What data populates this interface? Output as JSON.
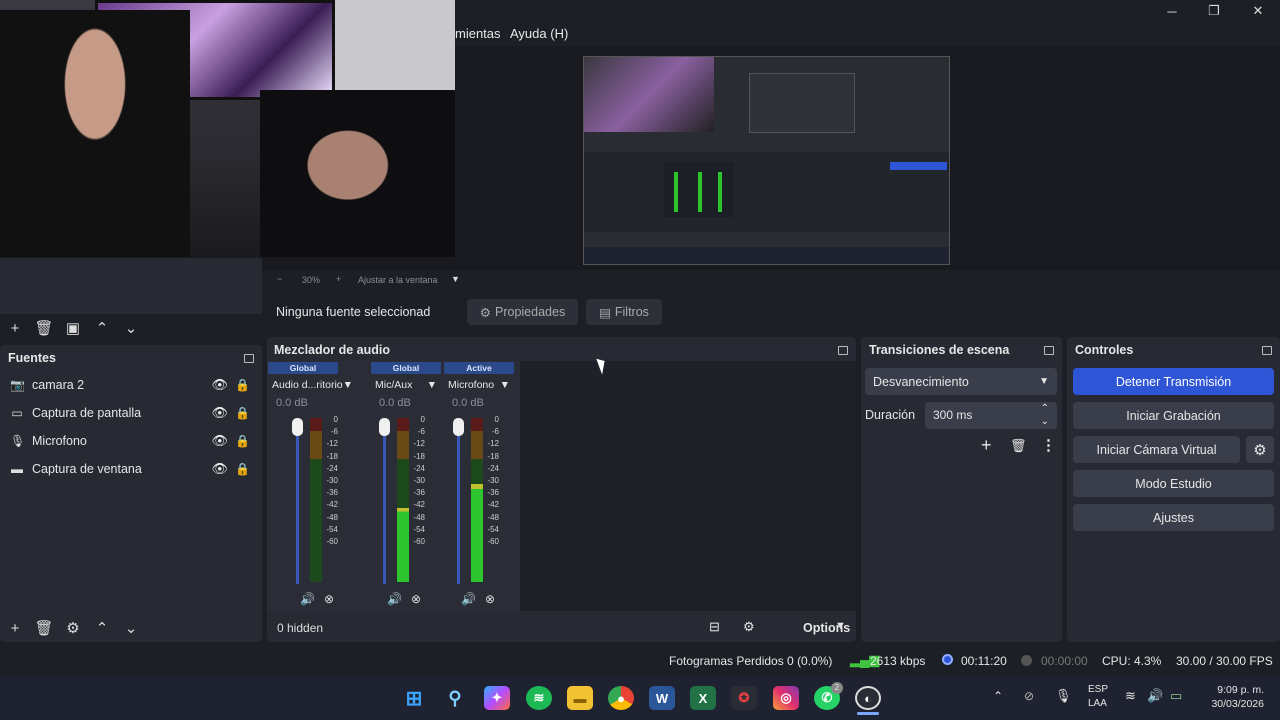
{
  "window": {
    "minimize": "─",
    "maximize": "❐",
    "close": "✕"
  },
  "menu": {
    "tools_partial": "mientas",
    "help": "Ayuda (H)"
  },
  "preview": {
    "zoom": "30%",
    "fit_label": "Ajustar a la ventana"
  },
  "source_bar": {
    "no_source": "Ninguna fuente seleccionad",
    "properties": "Propiedades",
    "filters": "Filtros"
  },
  "sources": {
    "title": "Fuentes",
    "items": [
      {
        "label": "camara 2",
        "icon": "camera-icon"
      },
      {
        "label": "Captura de pantalla",
        "icon": "monitor-icon"
      },
      {
        "label": "Microfono",
        "icon": "microphone-icon"
      },
      {
        "label": "Captura de ventana",
        "icon": "window-icon"
      }
    ]
  },
  "mixer": {
    "title": "Mezclador de audio",
    "hidden": "0 hidden",
    "options": "Options",
    "scale": [
      "0",
      "-6",
      "-12",
      "-18",
      "-24",
      "-30",
      "-36",
      "-42",
      "-48",
      "-54",
      "-60"
    ],
    "channels": [
      {
        "tag": "Global",
        "name": "Audio d...ritorio",
        "db": "0.0 dB",
        "level": 0
      },
      {
        "tag": "Global",
        "name": "Mic/Aux",
        "db": "0.0 dB",
        "level": 0.45
      },
      {
        "tag": "Active",
        "name": "Microfono",
        "db": "0.0 dB",
        "level": 0.6
      }
    ]
  },
  "transitions": {
    "title": "Transiciones de escena",
    "selected": "Desvanecimiento",
    "duration_label": "Duración",
    "duration_value": "300 ms"
  },
  "controls": {
    "title": "Controles",
    "stop_stream": "Detener Transmisión",
    "start_recording": "Iniciar Grabación",
    "virtual_cam": "Iniciar Cámara Virtual",
    "studio_mode": "Modo Estudio",
    "settings": "Ajustes"
  },
  "status": {
    "dropped": "Fotogramas Perdidos 0 (0.0%)",
    "bitrate": "2613 kbps",
    "stream_time": "00:11:20",
    "rec_time": "00:00:00",
    "cpu": "CPU: 4.3%",
    "fps": "30.00 / 30.00 FPS"
  },
  "taskbar": {
    "lang": "ESP",
    "layout": "LAA",
    "time": "9:09 p. m.",
    "date": "30/03/2026",
    "badge": "2"
  },
  "colors": {
    "accent": "#2d55d6",
    "panel": "#272a33",
    "bg": "#1d1f26"
  }
}
